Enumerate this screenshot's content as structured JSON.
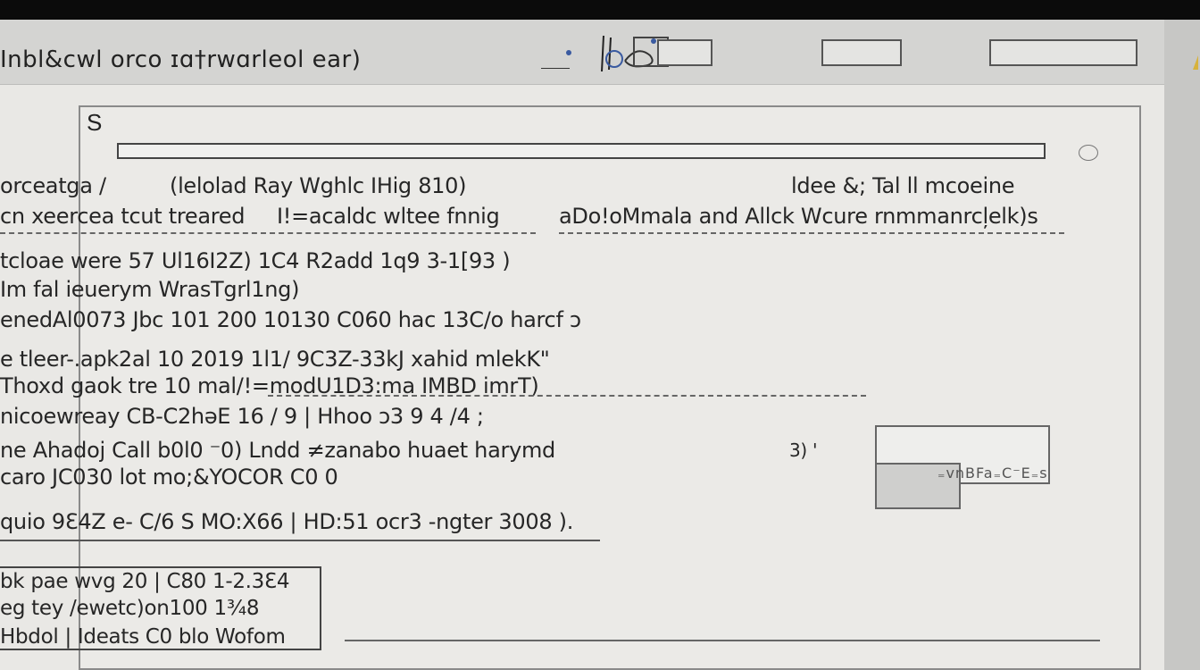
{
  "window": {
    "title": "Inbl&cwl orco ɪɑ†rwɑrleol ear)"
  },
  "toolbar": {
    "fields": [
      "",
      "",
      ""
    ]
  },
  "panel": {
    "glyph": "S"
  },
  "header": {
    "left": "orceatga /",
    "center": "(lelolad Ray Wghlc IHig 810)",
    "right": "ldee &; Tal ll mcoeine"
  },
  "subheader": {
    "left": "cn xeercea tcut treared",
    "mid": "I!=acaldc wltee fnnig",
    "right": "aDo!oMmala and Allck Wcure rnmmanrcļelk)s"
  },
  "lines": [
    "tcloae were 57 Ul16I2Z) 1C4  R2add 1q9 3-1[93 )",
    "Im fal ieuerym WrasTgrl1ng)",
    "enedAl0073 Jbc 101 200 10130 C060 hac 13C/o harcf ɔ",
    "e tleer-.apk2al 10 2019 1l1/ 9C3Z-33kJ xahid mlekK\"",
    "Thoxd gaok tre 10 mal/!=modU1D3:ma  IMBD  imrT)",
    "nicoewreay CB-C2hǝE 16 / 9 | Hhoo ɔ3 9 4 /4 ;",
    "ne Ahadoj Call  b0l0 ⁻0)  Lndd ≠zanabo huaet harymd",
    "caro JC030  lot mo;&YOCOR C0 0"
  ],
  "note": "3) '",
  "footer_line": "quio 9Ɛ4Z   e- C/6 S MO:X66 | HD:51 ocr3 -ngter 3008    ).",
  "thumbnail": {
    "caption": "₌vnBFa₌C⁻E₌s"
  },
  "bottom_box": [
    "bk pae wvg 20 | C80  1-2.3Ɛ4",
    "eg tey /ewetc)on100 1¾8",
    "Hbdol | Ideats C0 blo Wofom"
  ]
}
